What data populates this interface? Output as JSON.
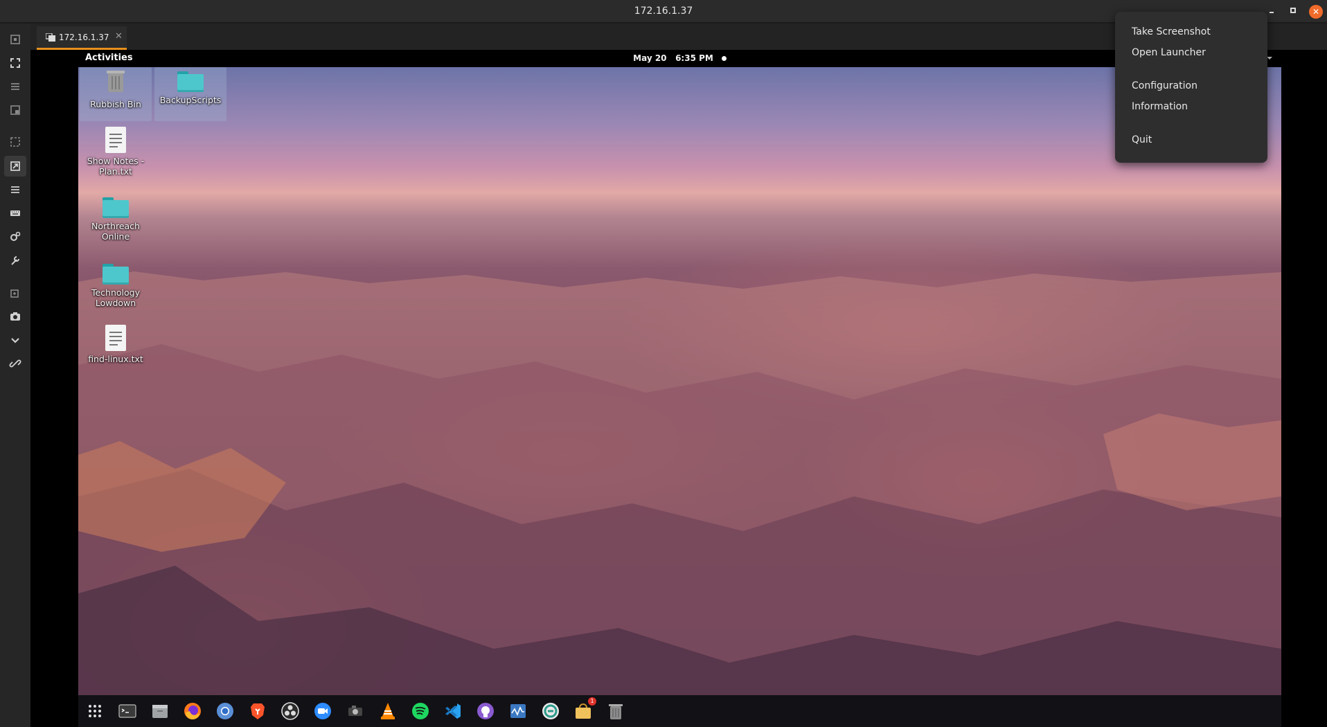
{
  "window": {
    "title": "172.16.1.37"
  },
  "window_controls": {
    "minimize_icon": "minimize-icon",
    "maximize_icon": "maximize-icon",
    "close_icon": "close-icon",
    "close_glyph": "✕"
  },
  "tab": {
    "label": "172.16.1.37",
    "close_glyph": "✕"
  },
  "left_toolbar": {
    "icons": [
      "fit-window-icon",
      "fullscreen-icon",
      "menu-icon",
      "window-icon",
      "scale-icon",
      "resize-icon",
      "list-icon",
      "keyboard-icon",
      "preferences-icon",
      "tools-icon",
      "duplicate-icon",
      "camera-icon",
      "chevron-down-icon",
      "disconnect-icon"
    ]
  },
  "remote_topbar": {
    "activities": "Activities",
    "date": "May 20",
    "time": "6:35 PM"
  },
  "desktop_icons": [
    {
      "label": "Rubbish Bin",
      "type": "trash"
    },
    {
      "label": "BackupScripts",
      "type": "folder"
    },
    {
      "label": "Show Notes - Plan.txt",
      "type": "document"
    },
    {
      "label": "Northreach Online",
      "type": "folder"
    },
    {
      "label": "Technology Lowdown",
      "type": "folder"
    },
    {
      "label": "find-linux.txt",
      "type": "document"
    }
  ],
  "dock": {
    "items": [
      "show-apps-icon",
      "terminal-icon",
      "files-icon",
      "firefox-icon",
      "chromium-icon",
      "brave-icon",
      "obs-icon",
      "zoom-icon",
      "screenshot-tool-icon",
      "vlc-icon",
      "spotify-icon",
      "vscode-icon",
      "github-desktop-icon",
      "system-monitor-icon",
      "remmina-icon",
      "software-store-icon",
      "trash-icon"
    ],
    "store_badge": "1"
  },
  "context_menu": {
    "items": [
      "Take Screenshot",
      "Open Launcher",
      "Configuration",
      "Information",
      "Quit"
    ]
  },
  "colors": {
    "accent": "#e8911d",
    "close_button": "#f06b2a",
    "folder": "#4dc7cb"
  }
}
